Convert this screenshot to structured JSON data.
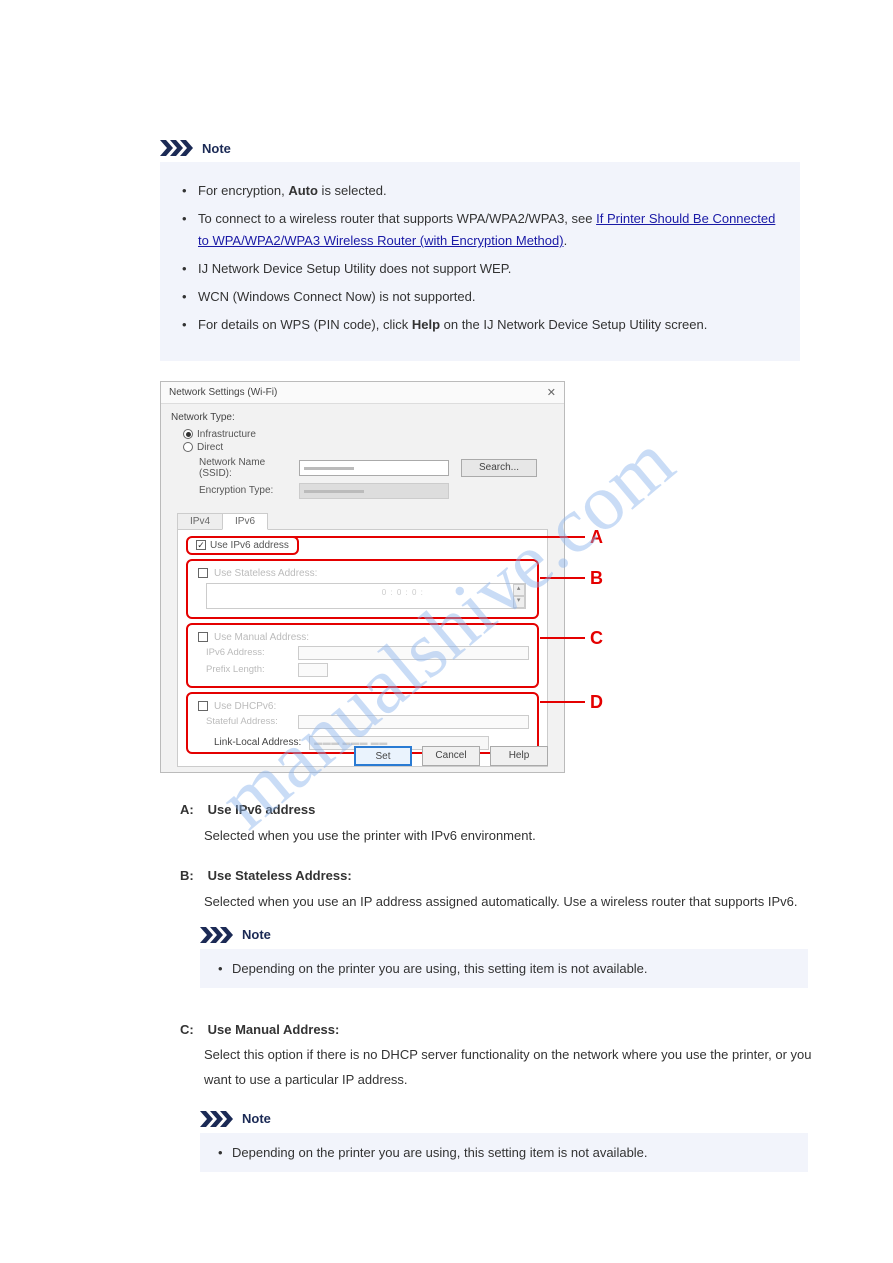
{
  "watermark": "manualshive.com",
  "top_note": {
    "items": [
      {
        "prefix": "For encryption, ",
        "bold": "Auto",
        "rest": " is selected."
      },
      {
        "plain": "To connect to a wireless router that supports WPA/WPA2/WPA3, see "
      },
      {
        "link_text": "If Printer Should Be Connected to WPA/WPA2/WPA3 Wireless Router (with Encryption Method)",
        "after": "."
      },
      {
        "plain": "IJ Network Device Setup Utility does not support WEP."
      },
      {
        "plain": "WCN (Windows Connect Now) is not supported."
      },
      {
        "plain": "For details on WPS (PIN code), click ",
        "bold": "Help",
        "rest": " on the IJ Network Device Setup Utility screen."
      }
    ]
  },
  "dialog": {
    "title": "Network Settings (Wi-Fi)",
    "close": "✕",
    "net_type": "Network Type:",
    "infra": "Infrastructure",
    "direct": "Direct",
    "ssid_label": "Network Name (SSID):",
    "enc_label": "Encryption Type:",
    "search_btn": "Search...",
    "tabs": {
      "ipv4": "IPv4",
      "ipv6": "IPv6"
    },
    "boxA": {
      "chk_label": "Use IPv6 address"
    },
    "boxB": {
      "chk_label": "Use Stateless Address:"
    },
    "boxC": {
      "chk_label": "Use Manual Address:",
      "addr": "IPv6 Address:",
      "prefix": "Prefix Length:"
    },
    "boxD": {
      "chk_label": "Use DHCPv6:",
      "sa": "Stateful Address:"
    },
    "link_local": "Link-Local Address:",
    "btns": {
      "set": "Set",
      "cancel": "Cancel",
      "help": "Help"
    },
    "callouts": [
      "A",
      "B",
      "C",
      "D"
    ]
  },
  "a_list": {
    "A": "Use IPv6 address",
    "A_desc": "Selected when you use the printer with IPv6 environment.",
    "B": "Use Stateless Address:",
    "B_desc": "Selected when you use an IP address assigned automatically. Use a wireless router that supports IPv6."
  },
  "b_note": "Depending on the printer you are using, this setting item is not available.",
  "bottom": {
    "C": "Use Manual Address:",
    "C_desc": "Select this option if there is no DHCP server functionality on the network where you use the printer, or you want to use a particular IP address."
  },
  "d_note": "Depending on the printer you are using, this setting item is not available.",
  "note_label": "Note"
}
